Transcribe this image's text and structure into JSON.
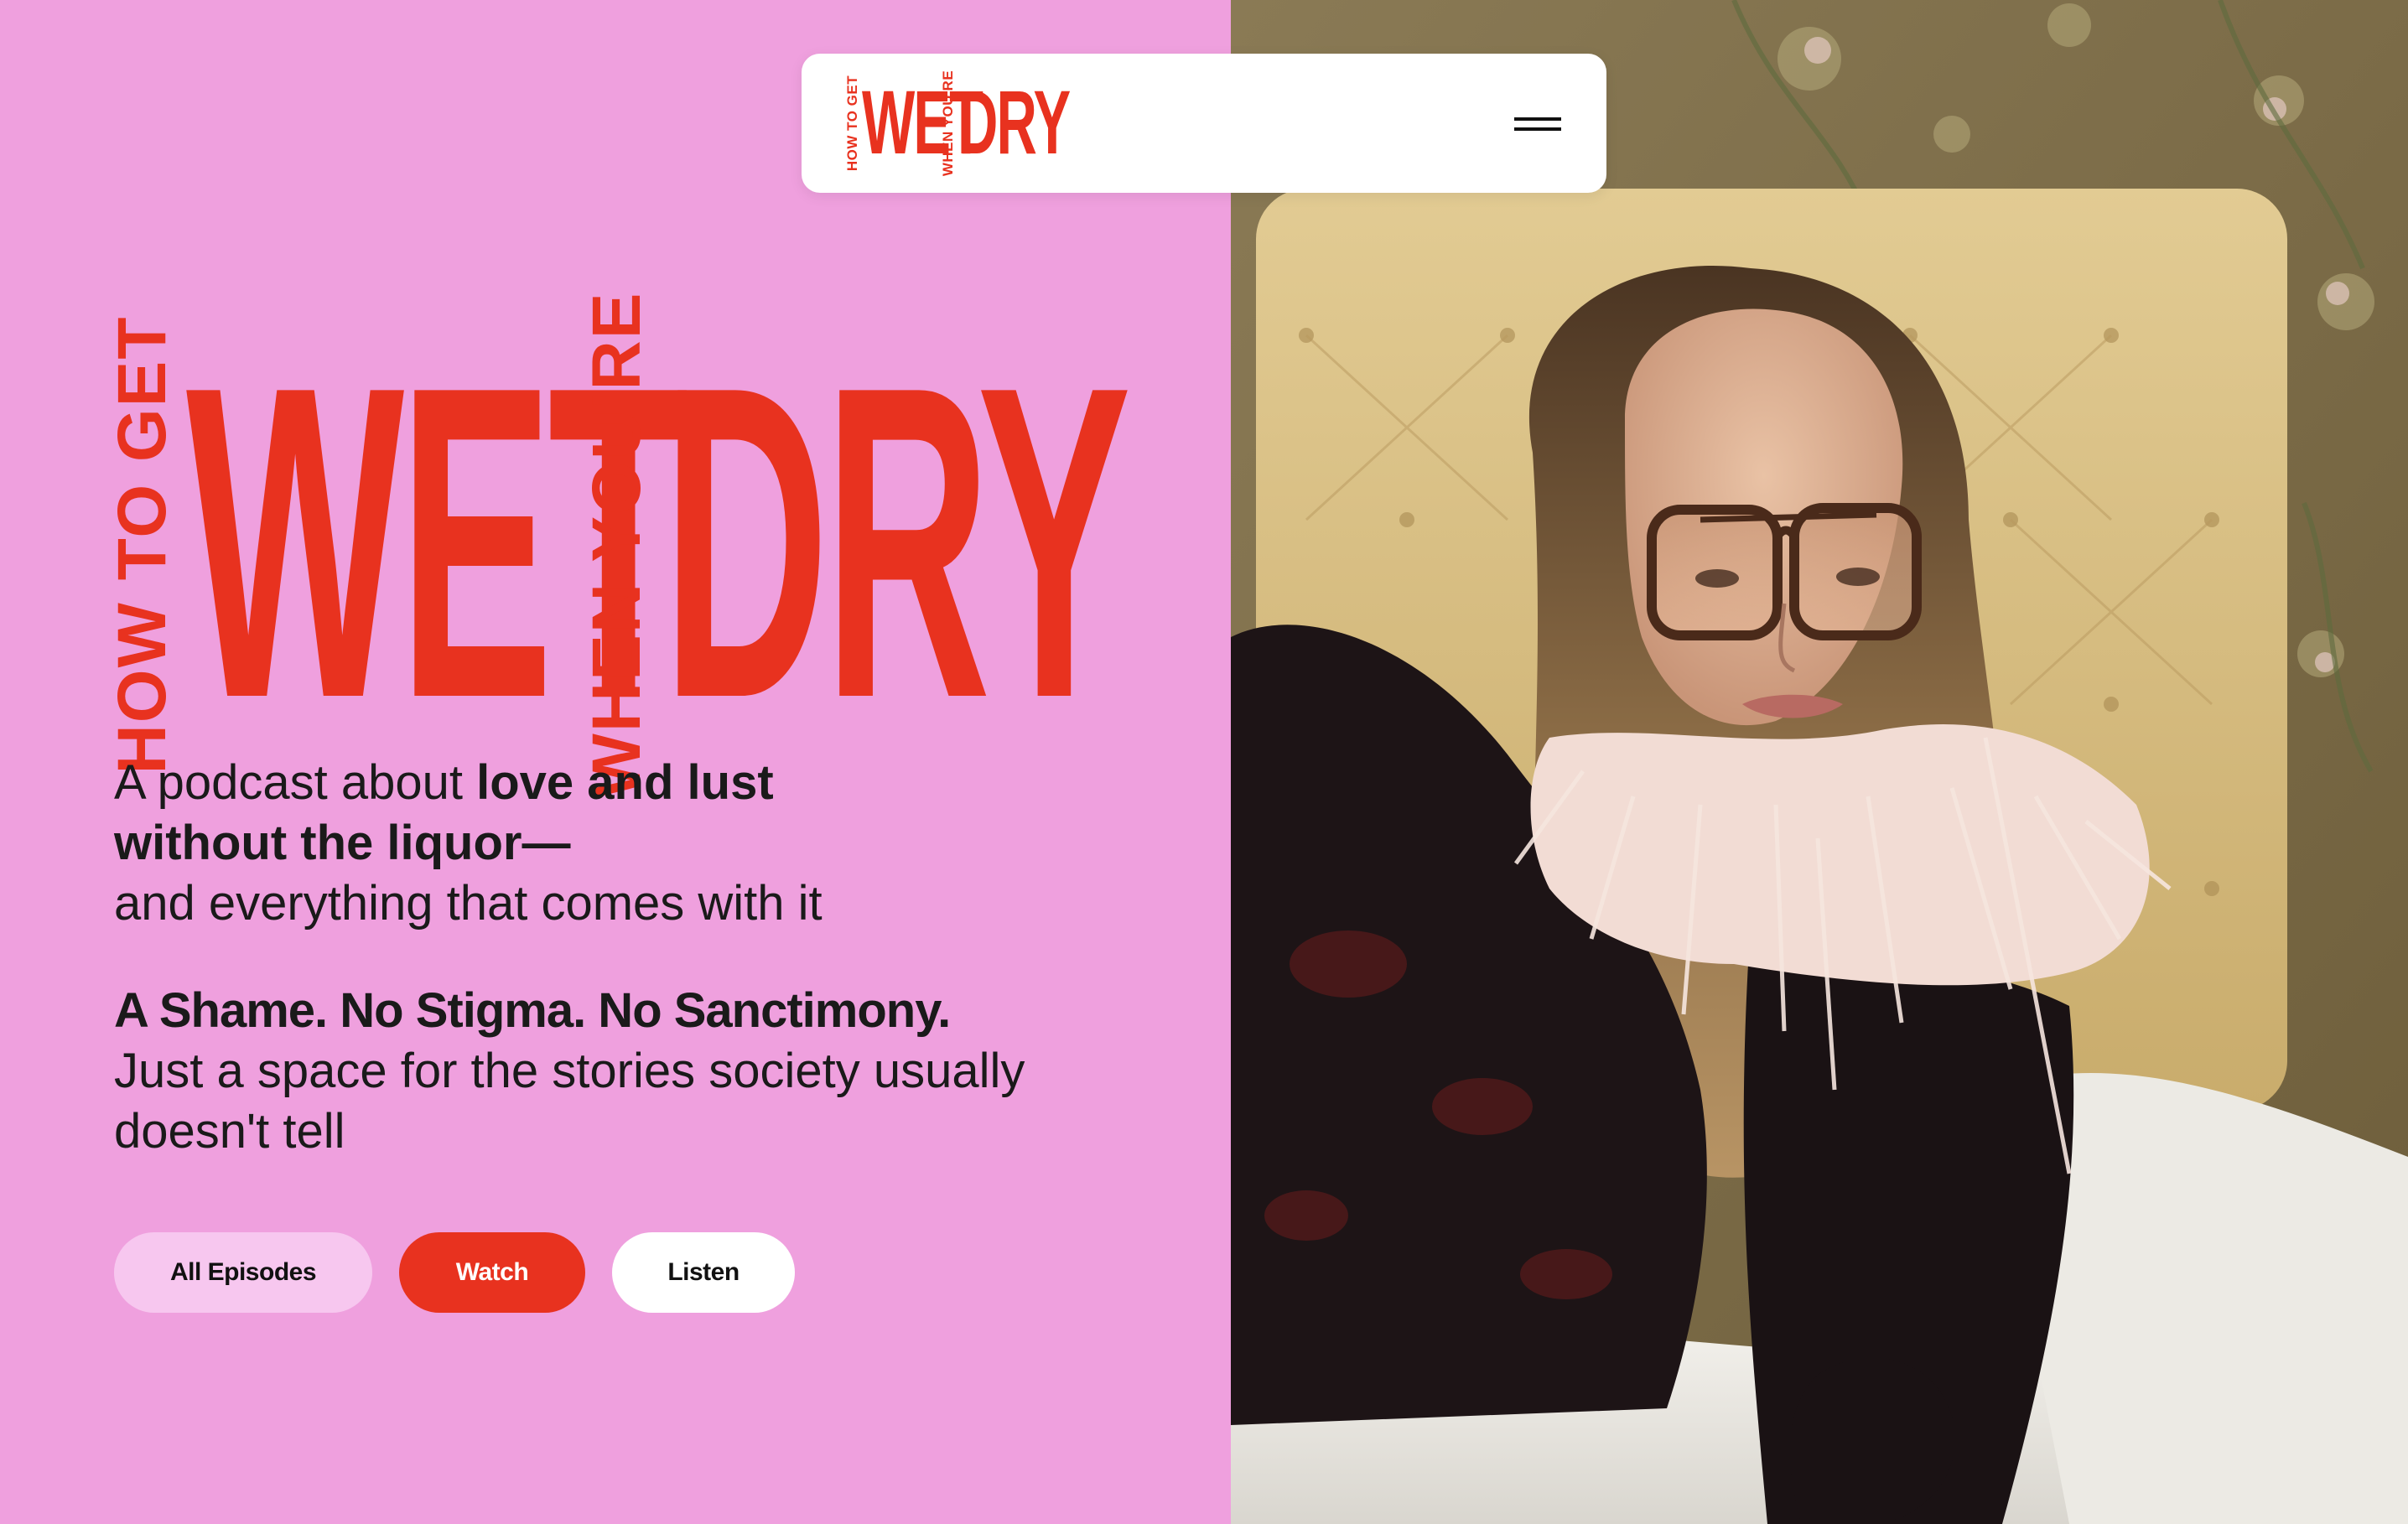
{
  "brand": {
    "logo_small": {
      "left_vertical": "HOW TO GET",
      "first_word": "WET",
      "middle_vertical": "WHEN YOU'RE",
      "last_word": "DRY"
    },
    "hero_logo": {
      "left_vertical": "HOW TO GET",
      "first_word": "WET",
      "middle_vertical": "WHEN YOU'RE",
      "last_word": "DRY"
    },
    "accent_color": "#e8321f",
    "background_color": "#efa0de"
  },
  "header": {
    "menu_icon": "hamburger-menu-icon"
  },
  "hero": {
    "tagline": {
      "prefix": "A podcast about ",
      "bold_1": "love and lust",
      "bold_2": "without the liquor—",
      "suffix": "and everything that comes with it"
    },
    "manifesto": {
      "bold": "A Shame. No Stigma. No Sanctimony.",
      "rest": "Just a space for the stories society usually doesn't tell"
    },
    "buttons": {
      "all_episodes": "All Episodes",
      "watch": "Watch",
      "listen": "Listen"
    }
  },
  "photo": {
    "subject": "portrait-photo"
  }
}
